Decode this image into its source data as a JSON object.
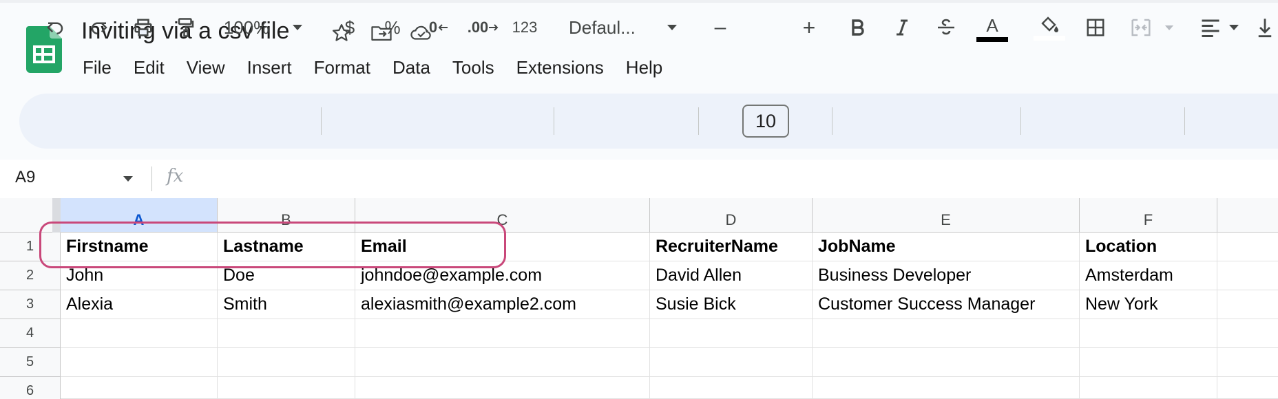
{
  "app": {
    "title": "Inviting via a csv file"
  },
  "menu": [
    "File",
    "Edit",
    "View",
    "Insert",
    "Format",
    "Data",
    "Tools",
    "Extensions",
    "Help"
  ],
  "toolbar": {
    "zoom": "100%",
    "currency": "$",
    "percent": "%",
    "decrease_decimal": ".0",
    "increase_decimal": ".00",
    "number_format": "123",
    "font": "Defaul...",
    "font_size_minus": "–",
    "font_size": "10",
    "font_size_plus": "+",
    "text_color_letter": "A",
    "icons": [
      "undo-icon",
      "redo-icon",
      "print-icon",
      "paint-format-icon",
      "bold-icon",
      "italic-icon",
      "strikethrough-icon",
      "text-color-icon",
      "fill-color-icon",
      "borders-icon",
      "merge-cells-icon",
      "horizontal-align-icon",
      "vertical-align-icon"
    ]
  },
  "formula_bar": {
    "name_box": "A9",
    "fx": "fx"
  },
  "sheet": {
    "columns": [
      "A",
      "B",
      "C",
      "D",
      "E",
      "F"
    ],
    "rows": [
      "1",
      "2",
      "3",
      "4",
      "5",
      "6"
    ],
    "cells": [
      [
        "Firstname",
        "Lastname",
        "Email",
        "RecruiterName",
        "JobName",
        "Location"
      ],
      [
        "John",
        "Doe",
        "johndoe@example.com",
        "David Allen",
        "Business Developer",
        "Amsterdam"
      ],
      [
        "Alexia",
        "Smith",
        "alexiasmith@example2.com",
        "Susie Bick",
        "Customer Success Manager",
        "New York"
      ],
      [
        "",
        "",
        "",
        "",
        "",
        ""
      ],
      [
        "",
        "",
        "",
        "",
        "",
        ""
      ],
      [
        "",
        "",
        "",
        "",
        "",
        ""
      ]
    ],
    "selected_column": "A"
  },
  "colors": {
    "accent": "#0b57d0",
    "highlight_outline": "#c9487a",
    "logo_green": "#0f9d58"
  }
}
